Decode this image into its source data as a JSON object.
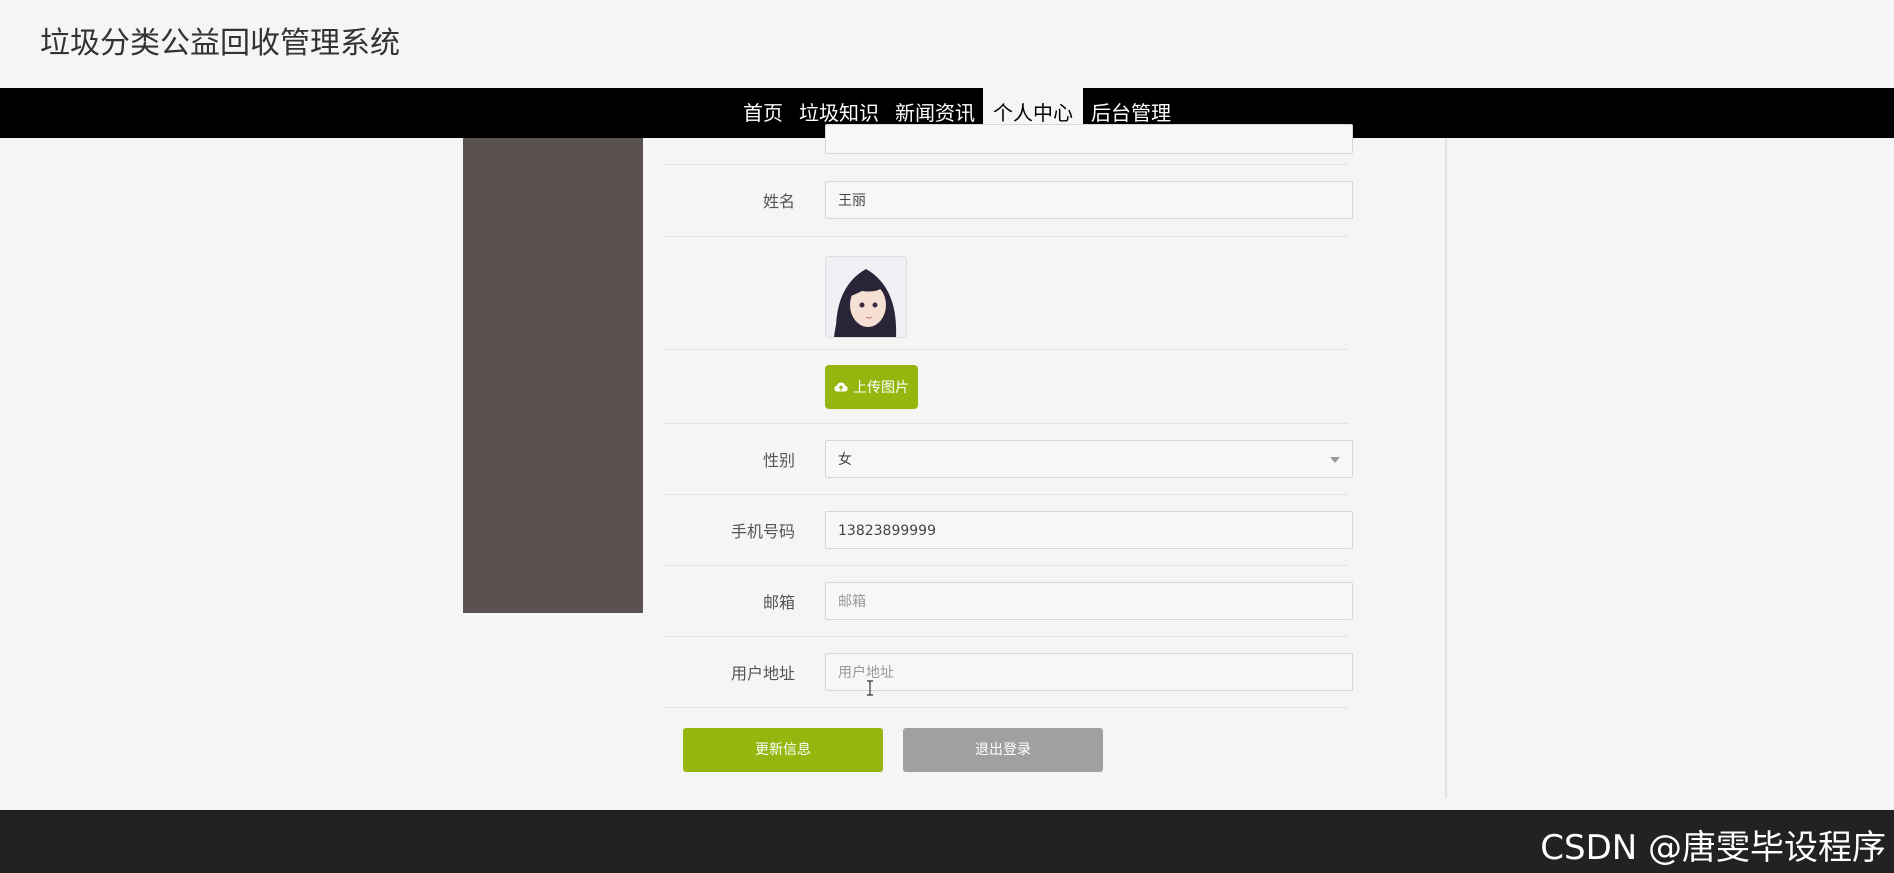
{
  "app": {
    "title": "垃圾分类公益回收管理系统"
  },
  "nav": {
    "items": [
      {
        "label": "首页"
      },
      {
        "label": "垃圾知识"
      },
      {
        "label": "新闻资讯"
      },
      {
        "label": "个人中心",
        "active": true
      },
      {
        "label": "后台管理"
      }
    ]
  },
  "form": {
    "name_label": "姓名",
    "name_value": "王丽",
    "upload_label": "上传图片",
    "gender_label": "性别",
    "gender_value": "女",
    "phone_label": "手机号码",
    "phone_value": "13823899999",
    "email_label": "邮箱",
    "email_placeholder": "邮箱",
    "address_label": "用户地址",
    "address_placeholder": "用户地址"
  },
  "buttons": {
    "update": "更新信息",
    "logout": "退出登录"
  },
  "footer": {
    "watermark": "CSDN @唐雯毕设程序"
  },
  "colors": {
    "accent": "#94b60f",
    "nav_bg": "#000000",
    "secondary": "#a0a0a0"
  }
}
